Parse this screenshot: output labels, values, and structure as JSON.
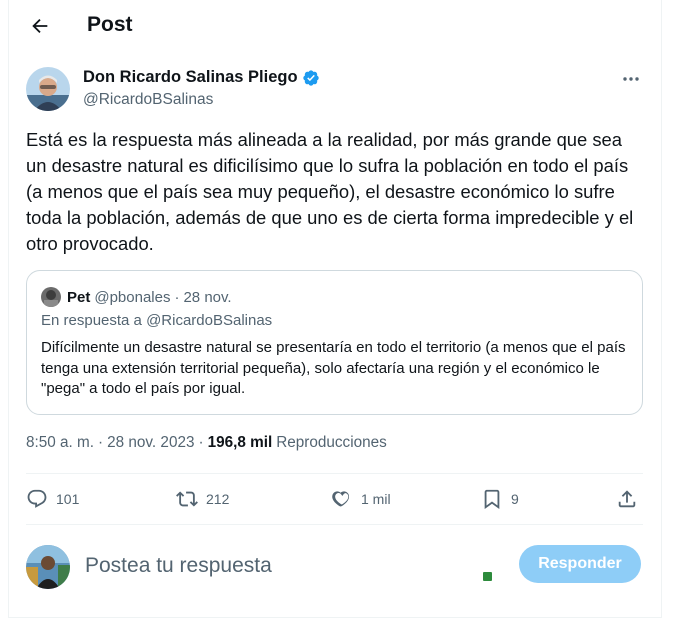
{
  "header": {
    "title": "Post"
  },
  "author": {
    "name": "Don Ricardo Salinas Pliego",
    "handle": "@RicardoBSalinas"
  },
  "post": {
    "text": "Está es la respuesta más alineada a la realidad, por más grande que sea un desastre natural es dificilísimo que lo sufra la población en todo el país (a menos que el país sea muy pequeño), el desastre económico lo sufre toda la población, además de que uno es de cierta forma impredecible y el otro provocado."
  },
  "quote": {
    "name": "Pet",
    "handle": "@pbonales",
    "separator": "·",
    "date": "28 nov.",
    "reply_to": "En respuesta a @RicardoBSalinas",
    "text": "Difícilmente un desastre natural se presentaría en todo el territorio (a menos que el país tenga una extensión territorial pequeña), solo afectaría una región y el económico le \"pega\" a todo el país por igual."
  },
  "meta": {
    "time": "8:50 a. m.",
    "separator1": "·",
    "date": "28 nov. 2023",
    "separator2": "·",
    "views_count": "196,8 mil",
    "views_label": "Reproducciones"
  },
  "actions": {
    "replies": "101",
    "reposts": "212",
    "likes": "1 mil",
    "bookmarks": "9"
  },
  "reply_box": {
    "placeholder": "Postea tu respuesta",
    "button_label": "Responder"
  },
  "colors": {
    "accent": "#1d9bf0",
    "button_disabled": "#8ecdf7",
    "secondary_text": "#536471",
    "border": "#cfd9de"
  },
  "icons": {
    "back": "arrow-left-icon",
    "verified": "verified-badge-icon",
    "more": "more-dots-icon",
    "reply": "reply-bubble-icon",
    "repost": "repost-icon",
    "like": "heart-icon",
    "bookmark": "bookmark-icon",
    "share": "share-icon"
  }
}
